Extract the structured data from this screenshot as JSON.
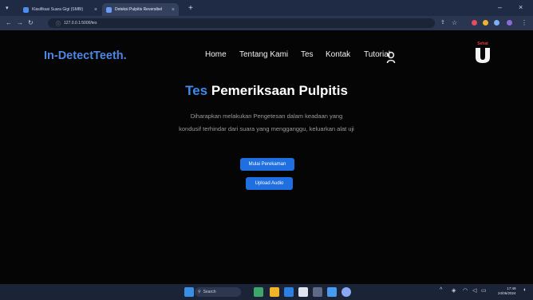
{
  "browser": {
    "tabs": [
      {
        "title": "Klasifikasi Suara Gigi (SMBI)",
        "color": "#4d8df0"
      },
      {
        "title": "Deteksi Pulpitis Reversibel",
        "color": "#6c9cf5"
      }
    ],
    "new_tab": "+",
    "minimize": "–",
    "close": "×",
    "address": "127.0.0.1:5000/tes"
  },
  "site": {
    "logo": "In-DetectTeeth.",
    "nav": [
      "Home",
      "Tentang Kami",
      "Tes",
      "Kontak",
      "Tutorial"
    ],
    "badge_label": "Sehat",
    "hero_accent": "Tes",
    "hero_title": "Pemeriksaan Pulpitis",
    "description": "Diharapkan melakukan Pengetesan dalam keadaan yang kondusif terhindar dari suara yang mengganggu, keluarkan alat uji",
    "record_button": "Mulai Perekaman",
    "upload_button": "Upload Audio",
    "accent_color": "#3d8bef"
  },
  "taskbar": {
    "search_placeholder": "Search",
    "time": "17:49",
    "date": "24/06/2024"
  }
}
